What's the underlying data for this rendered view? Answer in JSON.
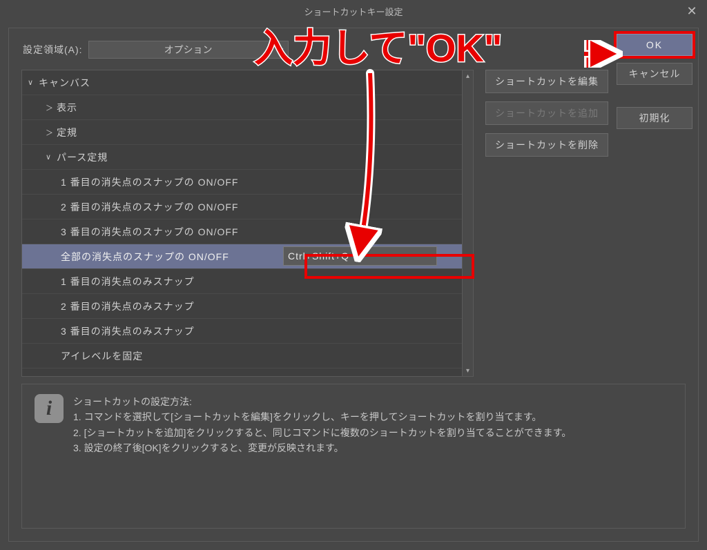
{
  "title": "ショートカットキー設定",
  "close": "✕",
  "area_label": "設定領域(A):",
  "area_value": "オプション",
  "tree": {
    "root": "キャンバス",
    "items": [
      {
        "label": "表示",
        "arrow": "＞"
      },
      {
        "label": "定規",
        "arrow": "＞"
      },
      {
        "label": "パース定規",
        "arrow": "∨",
        "children": [
          "1 番目の消失点のスナップの ON/OFF",
          "2 番目の消失点のスナップの ON/OFF",
          "3 番目の消失点のスナップの ON/OFF",
          "全部の消失点のスナップの ON/OFF",
          "1 番目の消失点のみスナップ",
          "2 番目の消失点のみスナップ",
          "3 番目の消失点のみスナップ",
          "アイレベルを固定"
        ]
      }
    ]
  },
  "shortcut_value": "Ctrl+Shift+Q",
  "side_buttons": {
    "edit": "ショートカットを編集",
    "add": "ショートカットを追加",
    "del": "ショートカットを削除"
  },
  "right_buttons": {
    "ok": "OK",
    "cancel": "キャンセル",
    "reset": "初期化"
  },
  "info": {
    "title": "ショートカットの設定方法:",
    "l1": "1. コマンドを選択して[ショートカットを編集]をクリックし、キーを押してショートカットを割り当てます。",
    "l2": "2. [ショートカットを追加]をクリックすると、同じコマンドに複数のショートカットを割り当てることができます。",
    "l3": "3. 設定の終了後[OK]をクリックすると、変更が反映されます。"
  },
  "annotation": "入力して\"OK\""
}
